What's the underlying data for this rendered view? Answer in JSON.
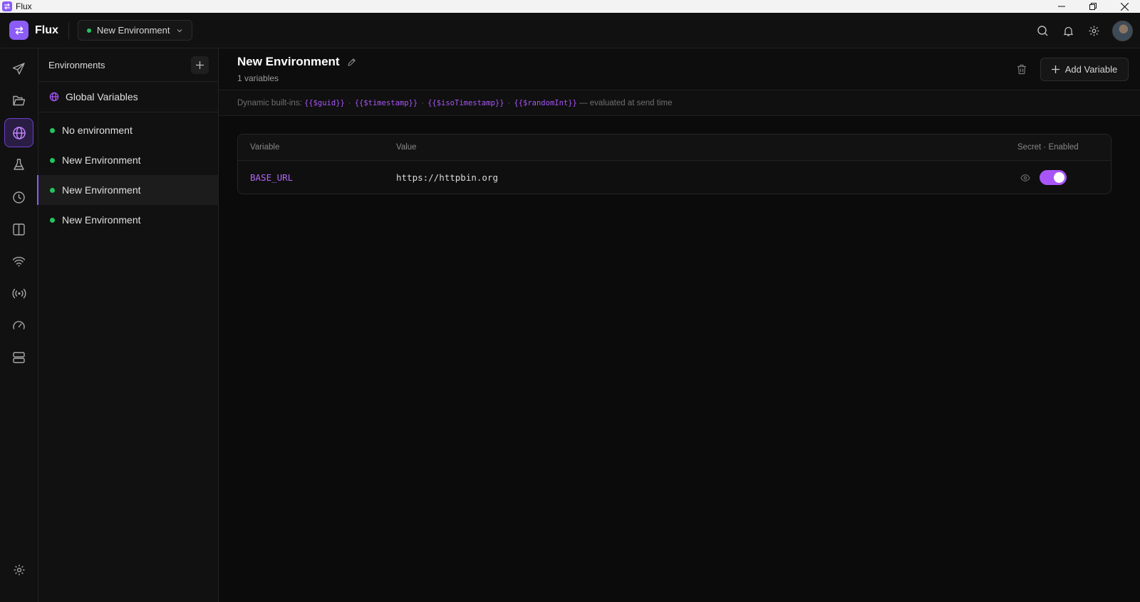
{
  "window": {
    "title": "Flux"
  },
  "header": {
    "app_name": "Flux",
    "env_selector": {
      "label": "New Environment",
      "status_color": "#22c55e"
    },
    "icons": [
      "search-icon",
      "bell-icon",
      "gear-icon"
    ]
  },
  "rail": {
    "items": [
      "send-icon",
      "folder-icon",
      "globe-icon",
      "flask-icon",
      "clock-icon",
      "columns-icon",
      "wifi-icon",
      "broadcast-icon",
      "gauge-icon",
      "server-icon"
    ],
    "active": "globe-icon",
    "bottom": "settings-icon"
  },
  "environments": {
    "title": "Environments",
    "global_label": "Global Variables",
    "items": [
      {
        "label": "No environment",
        "selected": false
      },
      {
        "label": "New Environment",
        "selected": false
      },
      {
        "label": "New Environment",
        "selected": true
      },
      {
        "label": "New Environment",
        "selected": false
      }
    ]
  },
  "main": {
    "title": "New Environment",
    "count_text": "1 variables",
    "add_label": "Add Variable",
    "builtins": {
      "prefix": "Dynamic built-ins:",
      "tokens": [
        "{{$guid}}",
        "{{$timestamp}}",
        "{{$isoTimestamp}}",
        "{{$randomInt}}"
      ],
      "separator": "·",
      "suffix": "— evaluated at send time"
    },
    "table": {
      "col_variable": "Variable",
      "col_value": "Value",
      "col_flags": "Secret · Enabled",
      "rows": [
        {
          "name": "BASE_URL",
          "value": "https://httpbin.org",
          "secret": false,
          "enabled": true
        }
      ]
    }
  },
  "colors": {
    "accent": "#8b5cf6",
    "accent_text": "#a855f7",
    "status_ok": "#22c55e",
    "background": "#0b0b0b"
  }
}
